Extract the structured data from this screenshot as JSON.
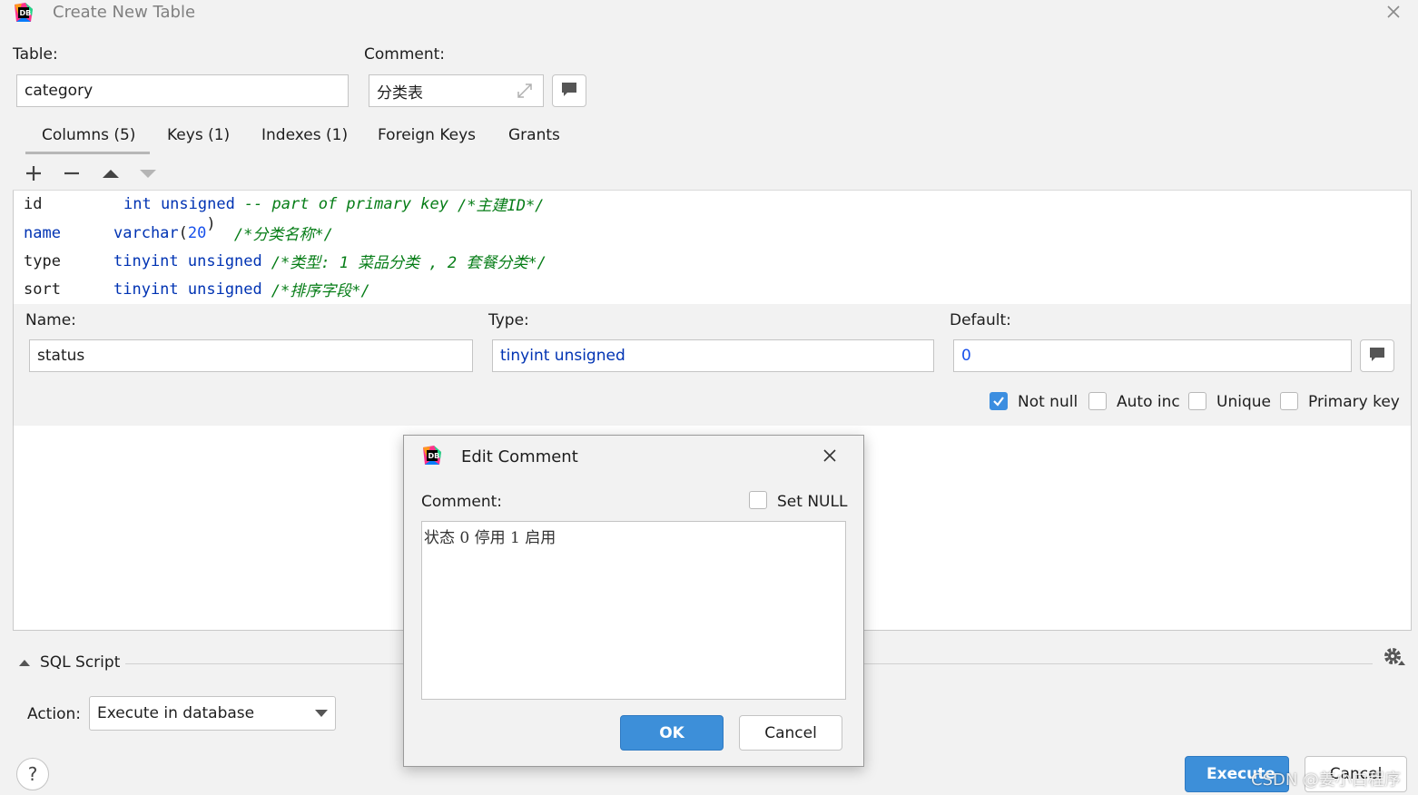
{
  "window": {
    "title": "Create New Table"
  },
  "table": {
    "label": "Table:",
    "value": "category"
  },
  "comment": {
    "label": "Comment:",
    "value": "分类表"
  },
  "tabs": [
    {
      "label": "Columns (5)"
    },
    {
      "label": "Keys (1)"
    },
    {
      "label": "Indexes (1)"
    },
    {
      "label": "Foreign Keys"
    },
    {
      "label": "Grants"
    }
  ],
  "columns": [
    {
      "name": "id",
      "type": "int unsigned",
      "extra": "-- part of primary key",
      "comment": "/*主建ID*/"
    },
    {
      "name": "name",
      "type": "varchar",
      "type_arg": "20",
      "comment": "/*分类名称*/"
    },
    {
      "name": "type",
      "type": "tinyint unsigned",
      "comment": "/*类型: 1 菜品分类 , 2 套餐分类*/"
    },
    {
      "name": "sort",
      "type": "tinyint unsigned",
      "comment": "/*排序字段*/"
    }
  ],
  "detail": {
    "name_label": "Name:",
    "name_value": "status",
    "type_label": "Type:",
    "type_value": "tinyint unsigned",
    "default_label": "Default:",
    "default_value": "0",
    "not_null_label": "Not null",
    "not_null_checked": true,
    "auto_inc_label": "Auto inc",
    "unique_label": "Unique",
    "primary_key_label": "Primary key"
  },
  "sql": {
    "label": "SQL Script",
    "action_label": "Action:",
    "action_value": "Execute in database"
  },
  "footer": {
    "help": "?",
    "execute": "Execute",
    "cancel": "Cancel",
    "watermark": "CSDN @姜小白程序"
  },
  "dialog": {
    "title": "Edit Comment",
    "comment_label": "Comment:",
    "set_null_label": "Set NULL",
    "text": "状态 0 停用 1 启用",
    "ok": "OK",
    "cancel": "Cancel"
  },
  "colors": {
    "accent": "#3d8fd9",
    "keyword": "#0033b3",
    "comment": "#067d17",
    "number": "#1750eb"
  }
}
